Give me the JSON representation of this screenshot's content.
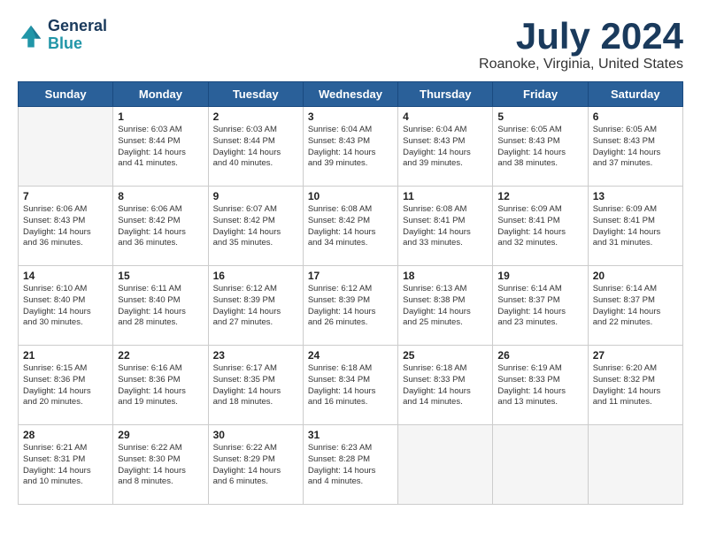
{
  "header": {
    "logo_line1": "General",
    "logo_line2": "Blue",
    "month_year": "July 2024",
    "location": "Roanoke, Virginia, United States"
  },
  "weekdays": [
    "Sunday",
    "Monday",
    "Tuesday",
    "Wednesday",
    "Thursday",
    "Friday",
    "Saturday"
  ],
  "weeks": [
    [
      {
        "day": "",
        "empty": true
      },
      {
        "day": "1",
        "sunrise": "6:03 AM",
        "sunset": "8:44 PM",
        "daylight": "14 hours and 41 minutes."
      },
      {
        "day": "2",
        "sunrise": "6:03 AM",
        "sunset": "8:44 PM",
        "daylight": "14 hours and 40 minutes."
      },
      {
        "day": "3",
        "sunrise": "6:04 AM",
        "sunset": "8:43 PM",
        "daylight": "14 hours and 39 minutes."
      },
      {
        "day": "4",
        "sunrise": "6:04 AM",
        "sunset": "8:43 PM",
        "daylight": "14 hours and 39 minutes."
      },
      {
        "day": "5",
        "sunrise": "6:05 AM",
        "sunset": "8:43 PM",
        "daylight": "14 hours and 38 minutes."
      },
      {
        "day": "6",
        "sunrise": "6:05 AM",
        "sunset": "8:43 PM",
        "daylight": "14 hours and 37 minutes."
      }
    ],
    [
      {
        "day": "7",
        "sunrise": "6:06 AM",
        "sunset": "8:43 PM",
        "daylight": "14 hours and 36 minutes."
      },
      {
        "day": "8",
        "sunrise": "6:06 AM",
        "sunset": "8:42 PM",
        "daylight": "14 hours and 36 minutes."
      },
      {
        "day": "9",
        "sunrise": "6:07 AM",
        "sunset": "8:42 PM",
        "daylight": "14 hours and 35 minutes."
      },
      {
        "day": "10",
        "sunrise": "6:08 AM",
        "sunset": "8:42 PM",
        "daylight": "14 hours and 34 minutes."
      },
      {
        "day": "11",
        "sunrise": "6:08 AM",
        "sunset": "8:41 PM",
        "daylight": "14 hours and 33 minutes."
      },
      {
        "day": "12",
        "sunrise": "6:09 AM",
        "sunset": "8:41 PM",
        "daylight": "14 hours and 32 minutes."
      },
      {
        "day": "13",
        "sunrise": "6:09 AM",
        "sunset": "8:41 PM",
        "daylight": "14 hours and 31 minutes."
      }
    ],
    [
      {
        "day": "14",
        "sunrise": "6:10 AM",
        "sunset": "8:40 PM",
        "daylight": "14 hours and 30 minutes."
      },
      {
        "day": "15",
        "sunrise": "6:11 AM",
        "sunset": "8:40 PM",
        "daylight": "14 hours and 28 minutes."
      },
      {
        "day": "16",
        "sunrise": "6:12 AM",
        "sunset": "8:39 PM",
        "daylight": "14 hours and 27 minutes."
      },
      {
        "day": "17",
        "sunrise": "6:12 AM",
        "sunset": "8:39 PM",
        "daylight": "14 hours and 26 minutes."
      },
      {
        "day": "18",
        "sunrise": "6:13 AM",
        "sunset": "8:38 PM",
        "daylight": "14 hours and 25 minutes."
      },
      {
        "day": "19",
        "sunrise": "6:14 AM",
        "sunset": "8:37 PM",
        "daylight": "14 hours and 23 minutes."
      },
      {
        "day": "20",
        "sunrise": "6:14 AM",
        "sunset": "8:37 PM",
        "daylight": "14 hours and 22 minutes."
      }
    ],
    [
      {
        "day": "21",
        "sunrise": "6:15 AM",
        "sunset": "8:36 PM",
        "daylight": "14 hours and 20 minutes."
      },
      {
        "day": "22",
        "sunrise": "6:16 AM",
        "sunset": "8:36 PM",
        "daylight": "14 hours and 19 minutes."
      },
      {
        "day": "23",
        "sunrise": "6:17 AM",
        "sunset": "8:35 PM",
        "daylight": "14 hours and 18 minutes."
      },
      {
        "day": "24",
        "sunrise": "6:18 AM",
        "sunset": "8:34 PM",
        "daylight": "14 hours and 16 minutes."
      },
      {
        "day": "25",
        "sunrise": "6:18 AM",
        "sunset": "8:33 PM",
        "daylight": "14 hours and 14 minutes."
      },
      {
        "day": "26",
        "sunrise": "6:19 AM",
        "sunset": "8:33 PM",
        "daylight": "14 hours and 13 minutes."
      },
      {
        "day": "27",
        "sunrise": "6:20 AM",
        "sunset": "8:32 PM",
        "daylight": "14 hours and 11 minutes."
      }
    ],
    [
      {
        "day": "28",
        "sunrise": "6:21 AM",
        "sunset": "8:31 PM",
        "daylight": "14 hours and 10 minutes."
      },
      {
        "day": "29",
        "sunrise": "6:22 AM",
        "sunset": "8:30 PM",
        "daylight": "14 hours and 8 minutes."
      },
      {
        "day": "30",
        "sunrise": "6:22 AM",
        "sunset": "8:29 PM",
        "daylight": "14 hours and 6 minutes."
      },
      {
        "day": "31",
        "sunrise": "6:23 AM",
        "sunset": "8:28 PM",
        "daylight": "14 hours and 4 minutes."
      },
      {
        "day": "",
        "empty": true
      },
      {
        "day": "",
        "empty": true
      },
      {
        "day": "",
        "empty": true
      }
    ]
  ]
}
